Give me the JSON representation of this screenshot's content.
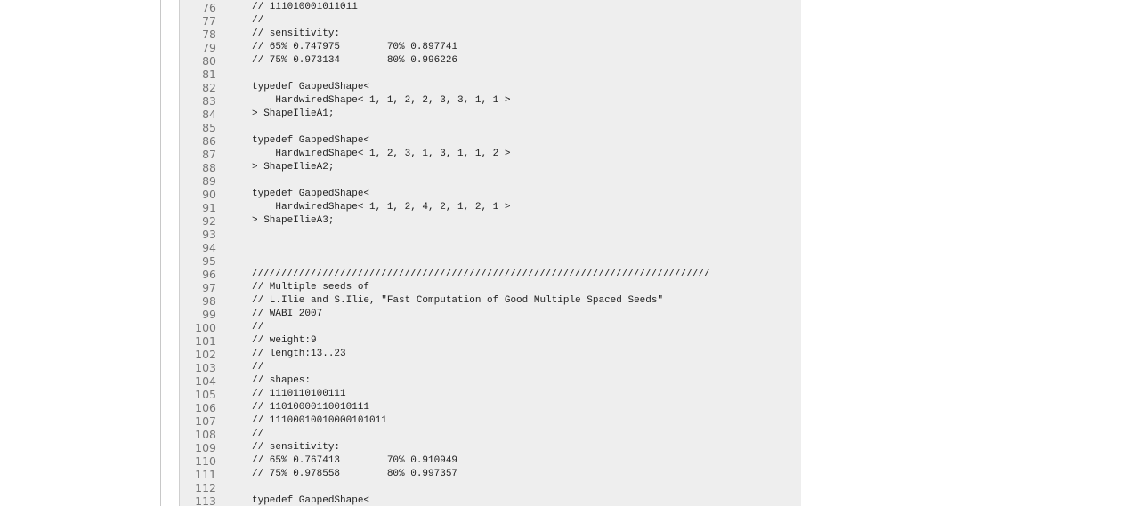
{
  "code_view": {
    "lines": [
      {
        "number": "76",
        "text": "// 111010001011011"
      },
      {
        "number": "77",
        "text": "//"
      },
      {
        "number": "78",
        "text": "// sensitivity:"
      },
      {
        "number": "79",
        "text": "// 65% 0.747975        70% 0.897741"
      },
      {
        "number": "80",
        "text": "// 75% 0.973134        80% 0.996226"
      },
      {
        "number": "81",
        "text": ""
      },
      {
        "number": "82",
        "text": "typedef GappedShape<"
      },
      {
        "number": "83",
        "text": "    HardwiredShape< 1, 1, 2, 2, 3, 3, 1, 1 >"
      },
      {
        "number": "84",
        "text": "> ShapeIlieA1;"
      },
      {
        "number": "85",
        "text": ""
      },
      {
        "number": "86",
        "text": "typedef GappedShape<"
      },
      {
        "number": "87",
        "text": "    HardwiredShape< 1, 2, 3, 1, 3, 1, 1, 2 >"
      },
      {
        "number": "88",
        "text": "> ShapeIlieA2;"
      },
      {
        "number": "89",
        "text": ""
      },
      {
        "number": "90",
        "text": "typedef GappedShape<"
      },
      {
        "number": "91",
        "text": "    HardwiredShape< 1, 1, 2, 4, 2, 1, 2, 1 >"
      },
      {
        "number": "92",
        "text": "> ShapeIlieA3;"
      },
      {
        "number": "93",
        "text": ""
      },
      {
        "number": "94",
        "text": ""
      },
      {
        "number": "95",
        "text": ""
      },
      {
        "number": "96",
        "text": "//////////////////////////////////////////////////////////////////////////////"
      },
      {
        "number": "97",
        "text": "// Multiple seeds of"
      },
      {
        "number": "98",
        "text": "// L.Ilie and S.Ilie, \"Fast Computation of Good Multiple Spaced Seeds\""
      },
      {
        "number": "99",
        "text": "// WABI 2007"
      },
      {
        "number": "100",
        "text": "//"
      },
      {
        "number": "101",
        "text": "// weight:9"
      },
      {
        "number": "102",
        "text": "// length:13..23"
      },
      {
        "number": "103",
        "text": "//"
      },
      {
        "number": "104",
        "text": "// shapes:"
      },
      {
        "number": "105",
        "text": "// 1110110100111"
      },
      {
        "number": "106",
        "text": "// 11010000110010111"
      },
      {
        "number": "107",
        "text": "// 11100010010000101011"
      },
      {
        "number": "108",
        "text": "//"
      },
      {
        "number": "109",
        "text": "// sensitivity:"
      },
      {
        "number": "110",
        "text": "// 65% 0.767413        70% 0.910949"
      },
      {
        "number": "111",
        "text": "// 75% 0.978558        80% 0.997357"
      },
      {
        "number": "112",
        "text": ""
      },
      {
        "number": "113",
        "text": "typedef GappedShape<"
      }
    ]
  }
}
